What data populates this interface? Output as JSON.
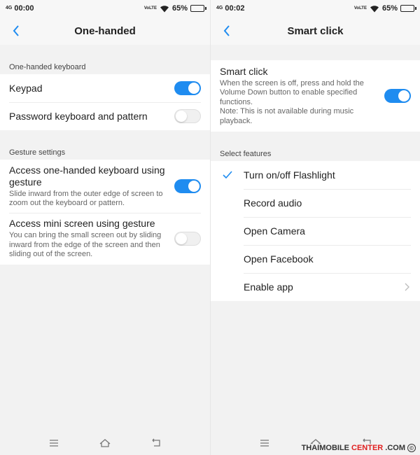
{
  "colors": {
    "accent": "#1f8cf0",
    "background": "#f2f2f2",
    "watermark_red": "#e02020"
  },
  "left": {
    "status": {
      "net": "4G",
      "time": "00:00",
      "volte": "VoLTE",
      "battery": "65%",
      "battery_level": 0.65
    },
    "nav": {
      "title": "One-handed",
      "back_icon": "back-chevron-icon"
    },
    "sections": [
      {
        "header": "One-handed keyboard",
        "rows": [
          {
            "title": "Keypad",
            "toggle": "on"
          },
          {
            "title": "Password keyboard and pattern",
            "toggle": "off"
          }
        ]
      },
      {
        "header": "Gesture settings",
        "rows": [
          {
            "title": "Access one-handed keyboard using gesture",
            "desc": "Slide inward from the outer edge of screen to zoom out the keyboard or pattern.",
            "toggle": "on"
          },
          {
            "title": "Access mini screen using gesture",
            "desc": "You can bring the small screen out by sliding inward from the edge of the screen and then sliding out of the screen.",
            "toggle": "off"
          }
        ]
      }
    ]
  },
  "right": {
    "status": {
      "net": "4G",
      "time": "00:02",
      "volte": "VoLTE",
      "battery": "65%",
      "battery_level": 0.65
    },
    "nav": {
      "title": "Smart click",
      "back_icon": "back-chevron-icon"
    },
    "smart_click": {
      "title": "Smart click",
      "desc": "When the screen is off, press and hold the Volume Down button to enable specified functions.",
      "note": "Note: This is not available during music playback.",
      "toggle": "on"
    },
    "features_header": "Select features",
    "features": [
      {
        "label": "Turn on/off Flashlight",
        "checked": true
      },
      {
        "label": "Record audio",
        "checked": false
      },
      {
        "label": "Open Camera",
        "checked": false
      },
      {
        "label": "Open Facebook",
        "checked": false
      },
      {
        "label": "Enable app",
        "checked": false,
        "chevron": true
      }
    ]
  },
  "bottom_nav": {
    "icons": [
      "menu-icon",
      "home-icon",
      "back-icon"
    ]
  },
  "watermark": {
    "part1": "THAIMOBILE",
    "part2": "CENTER",
    "part3": ".COM",
    "symbol": "©"
  }
}
